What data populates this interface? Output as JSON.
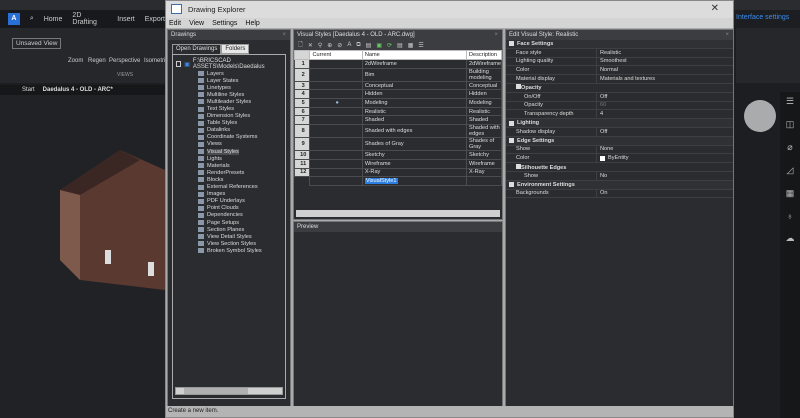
{
  "app": {
    "ribbon_tabs": [
      "Home",
      "2D Drafting",
      "Insert",
      "Export"
    ],
    "view_name": "Unsaved View",
    "ribbon_buttons": [
      "Zoom",
      "Regen",
      "Perspective",
      "Isometric"
    ],
    "group_label": "VIEWS",
    "doc_tabs": [
      "Start",
      "Daedalus 4 - OLD - ARC*"
    ],
    "interface_settings": "Interface settings"
  },
  "window": {
    "title": "Drawing Explorer",
    "menu": [
      "Edit",
      "View",
      "Settings",
      "Help"
    ],
    "status": "Create a new item."
  },
  "drawings": {
    "title": "Drawings",
    "tabs": [
      "Open Drawings",
      "Folders"
    ],
    "root": "F:\\BRICSCAD ASSETS\\Models\\Daedalus",
    "items": [
      "Layers",
      "Layer States",
      "Linetypes",
      "Multiline Styles",
      "Multileader Styles",
      "Text Styles",
      "Dimension Styles",
      "Table Styles",
      "Datalinks",
      "Coordinate Systems",
      "Views",
      "Visual Styles",
      "Lights",
      "Materials",
      "RenderPresets",
      "Blocks",
      "External References",
      "Images",
      "PDF Underlays",
      "Point Clouds",
      "Dependencies",
      "Page Setups",
      "Section Planes",
      "View Detail Styles",
      "View Section Styles",
      "Broken Symbol Styles"
    ],
    "selected": "Visual Styles"
  },
  "visual_styles": {
    "title": "Visual Styles [Daedalus 4 - OLD - ARC.dwg]",
    "columns": [
      "Current",
      "Name",
      "Description"
    ],
    "rows": [
      [
        "1",
        "",
        "2dWireframe",
        "2dWireframe"
      ],
      [
        "2",
        "",
        "Bim",
        "Building modeling"
      ],
      [
        "3",
        "",
        "Conceptual",
        "Conceptual"
      ],
      [
        "4",
        "",
        "Hidden",
        "Hidden"
      ],
      [
        "5",
        "●",
        "Modeling",
        "Modeling"
      ],
      [
        "6",
        "",
        "Realistic",
        "Realistic"
      ],
      [
        "7",
        "",
        "Shaded",
        "Shaded"
      ],
      [
        "8",
        "",
        "Shaded with edges",
        "Shaded with edges"
      ],
      [
        "9",
        "",
        "Shades of Gray",
        "Shades of Gray"
      ],
      [
        "10",
        "",
        "Sketchy",
        "Sketchy"
      ],
      [
        "11",
        "",
        "Wireframe",
        "Wireframe"
      ],
      [
        "12",
        "",
        "X-Ray",
        "X-Ray"
      ]
    ],
    "new_item": "VisualStyle1"
  },
  "preview": {
    "title": "Preview"
  },
  "edit": {
    "title": "Edit Visual Style: Realistic",
    "rows": [
      {
        "t": "cat",
        "k": "Face Settings"
      },
      {
        "t": "p",
        "k": "Face style",
        "v": "Realistic"
      },
      {
        "t": "p",
        "k": "Lighting quality",
        "v": "Smoothest"
      },
      {
        "t": "p",
        "k": "Color",
        "v": "Normal"
      },
      {
        "t": "p",
        "k": "Material display",
        "v": "Materials and textures"
      },
      {
        "t": "subcat",
        "k": "Opacity"
      },
      {
        "t": "sub",
        "k": "On/Off",
        "v": "Off"
      },
      {
        "t": "sub",
        "k": "Opacity",
        "v": "60",
        "dim": true
      },
      {
        "t": "sub",
        "k": "Transparency depth",
        "v": "4"
      },
      {
        "t": "cat",
        "k": "Lighting"
      },
      {
        "t": "p",
        "k": "Shadow display",
        "v": "Off"
      },
      {
        "t": "cat",
        "k": "Edge Settings"
      },
      {
        "t": "p",
        "k": "Show",
        "v": "None"
      },
      {
        "t": "p",
        "k": "Color",
        "v": "ByEntity"
      },
      {
        "t": "subcat",
        "k": "Silhouette Edges"
      },
      {
        "t": "sub",
        "k": "Show",
        "v": "No"
      },
      {
        "t": "cat",
        "k": "Environment Settings"
      },
      {
        "t": "p",
        "k": "Backgrounds",
        "v": "On"
      }
    ]
  }
}
